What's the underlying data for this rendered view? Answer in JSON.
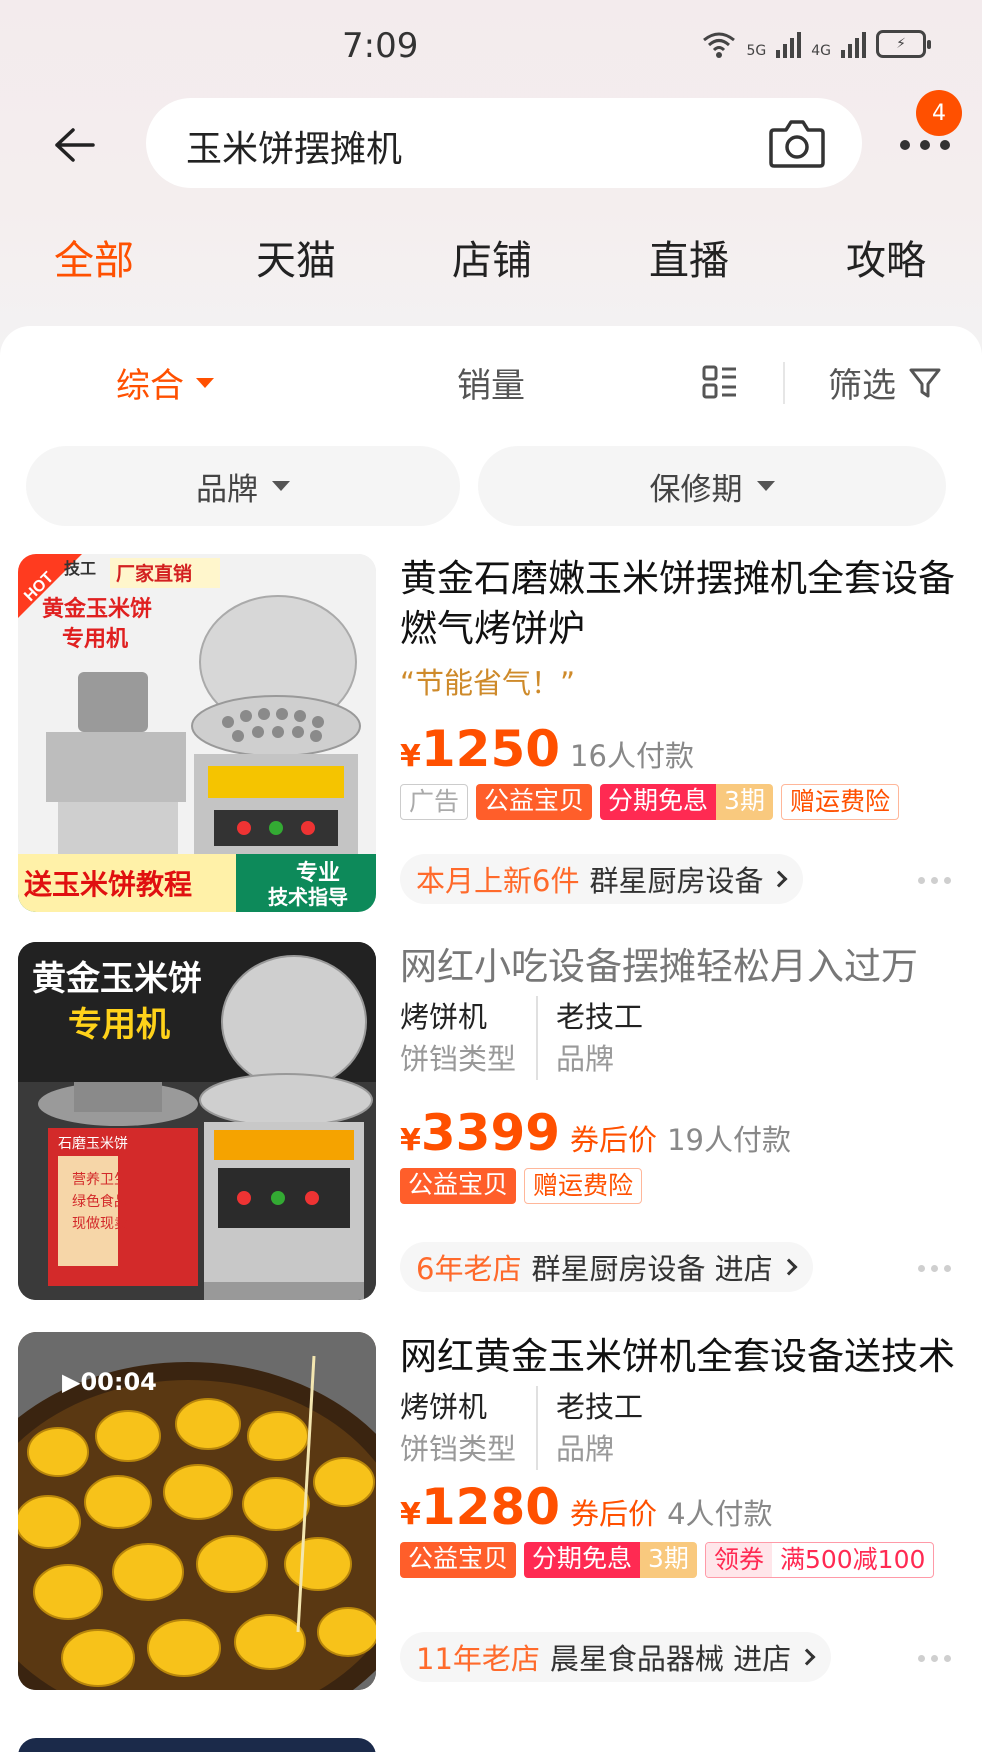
{
  "status_bar": {
    "time": "7:09",
    "net1": "5G",
    "net2": "4G",
    "wifi_label": "6"
  },
  "search": {
    "query": "玉米饼摆摊机",
    "more_badge": "4"
  },
  "tabs": [
    "全部",
    "天猫",
    "店铺",
    "直播",
    "攻略"
  ],
  "sort": {
    "comprehensive": "综合",
    "sales": "销量",
    "filter": "筛选"
  },
  "filters": [
    "品牌",
    "保修期"
  ],
  "products": [
    {
      "title": "黄金石磨嫩玉米饼摆摊机全套设备燃气烤饼炉",
      "slogan": "“节能省气！”",
      "currency": "¥",
      "price": "1250",
      "sales": "16人付款",
      "tags": {
        "ad": "广告",
        "charity": "公益宝贝",
        "installment": "分期免息",
        "installment_periods": "3期",
        "shipping_insurance": "赠运费险"
      },
      "shop_highlight": "本月上新6件",
      "shop_name": "群星厨房设备",
      "image_text": {
        "hot": "HOT",
        "brand": "技工",
        "factory": "厂家直销",
        "headline1": "黄金玉米饼",
        "headline2": "专用机",
        "bottom1": "送玉米饼教程",
        "bottom2": "专业",
        "bottom3": "技术指导"
      }
    },
    {
      "title": "网红小吃设备摆摊轻松月入过万",
      "attr1_value": "烤饼机",
      "attr1_key": "饼铛类型",
      "attr2_value": "老技工",
      "attr2_key": "品牌",
      "currency": "¥",
      "price": "3399",
      "after_coupon": "券后价",
      "sales": "19人付款",
      "tags": {
        "charity": "公益宝贝",
        "shipping_insurance": "赠运费险"
      },
      "shop_highlight": "6年老店",
      "shop_name": "群星厨房设备 进店",
      "image_text": {
        "headline1": "黄金玉米饼",
        "headline2": "专用机",
        "cabinet": "石磨玉米饼",
        "cabinet2": "营养卫生",
        "cabinet3": "绿色食品",
        "cabinet4": "现做现卖"
      }
    },
    {
      "title": "网红黄金玉米饼机全套设备送技术",
      "attr1_value": "烤饼机",
      "attr1_key": "饼铛类型",
      "attr2_value": "老技工",
      "attr2_key": "品牌",
      "currency": "¥",
      "price": "1280",
      "after_coupon": "券后价",
      "sales": "4人付款",
      "tags": {
        "charity": "公益宝贝",
        "installment": "分期免息",
        "installment_periods": "3期",
        "coupon": "领券",
        "coupon_value": "满500减100"
      },
      "shop_highlight": "11年老店",
      "shop_name": "晨星食品器械 进店",
      "video_duration": "▶00:04"
    }
  ],
  "colors": {
    "accent": "#ff5000",
    "installment": "#ff2a52",
    "slogan": "#ce8a2a"
  }
}
